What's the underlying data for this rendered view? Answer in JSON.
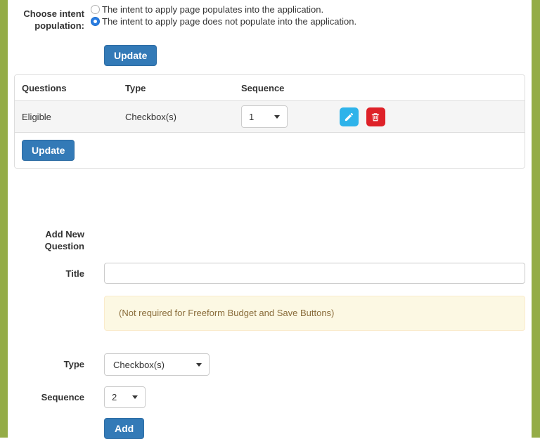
{
  "theme": {
    "accent_green": "#94ac47",
    "primary_blue": "#337ab7",
    "edit_blue": "#2eb3ea",
    "delete_red": "#de2128",
    "warning_bg": "#fcf8e3",
    "warning_text": "#8a6d3b"
  },
  "intent": {
    "label": "Choose intent population:",
    "options": [
      {
        "label": "The intent to apply page populates into the application.",
        "selected": false
      },
      {
        "label": "The intent to apply page does not populate into the application.",
        "selected": true
      }
    ],
    "update_label": "Update"
  },
  "questions_table": {
    "headers": [
      "Questions",
      "Type",
      "Sequence"
    ],
    "rows": [
      {
        "question": "Eligible",
        "type": "Checkbox(s)",
        "sequence": "1"
      }
    ],
    "edit_icon": "pencil-icon",
    "delete_icon": "trash-icon",
    "update_label": "Update"
  },
  "add_question": {
    "section_label": "Add New Question",
    "title_label": "Title",
    "title_value": "",
    "warning_text": "(Not required for Freeform Budget and Save Buttons)",
    "type_label": "Type",
    "type_value": "Checkbox(s)",
    "sequence_label": "Sequence",
    "sequence_value": "2",
    "add_label": "Add"
  }
}
